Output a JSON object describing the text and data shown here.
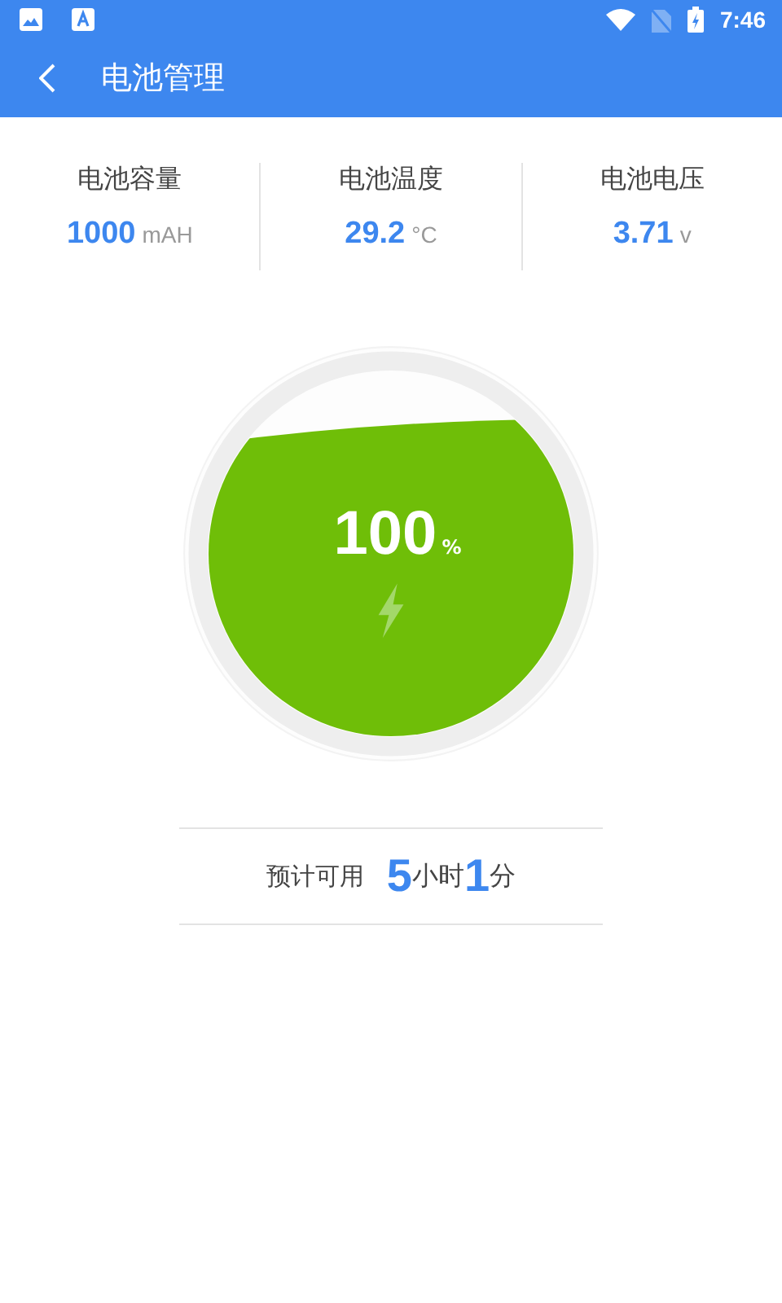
{
  "status_bar": {
    "time": "7:46"
  },
  "app_bar": {
    "title": "电池管理"
  },
  "stats": [
    {
      "label": "电池容量",
      "value": "1000",
      "unit": "mAH"
    },
    {
      "label": "电池温度",
      "value": "29.2",
      "unit": "°C"
    },
    {
      "label": "电池电压",
      "value": "3.71",
      "unit": "v"
    }
  ],
  "battery": {
    "percent": "100",
    "percent_sign": "%",
    "charging": true
  },
  "estimate": {
    "label": "预计可用",
    "hours": "5",
    "hours_unit": "小时",
    "minutes": "1",
    "minutes_unit": "分"
  }
}
